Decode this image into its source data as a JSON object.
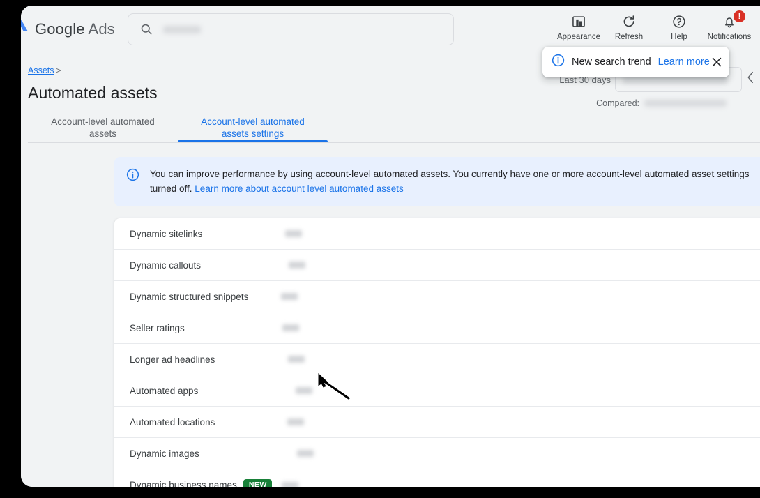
{
  "header": {
    "brand_google": "Google",
    "brand_ads": "Ads",
    "logo_icon": "google-ads-logo",
    "search": {
      "icon": "search-icon",
      "value": "",
      "placeholder": ""
    },
    "actions": [
      {
        "id": "appearance",
        "label": "Appearance",
        "icon": "appearance-icon"
      },
      {
        "id": "refresh",
        "label": "Refresh",
        "icon": "refresh-icon"
      },
      {
        "id": "help",
        "label": "Help",
        "icon": "help-icon"
      },
      {
        "id": "notifications",
        "label": "Notifications",
        "icon": "bell-icon",
        "badge": "!"
      }
    ]
  },
  "toast": {
    "icon": "info-icon",
    "message": "New search trend",
    "link": "Learn more",
    "close_icon": "close-icon"
  },
  "date_range": {
    "label": "Last 30 days",
    "value": "",
    "compared_label": "Compared:",
    "compared_value": "",
    "collapse_icon": "chevron-left-icon"
  },
  "breadcrumb": {
    "items": [
      "Assets"
    ],
    "separator": ">"
  },
  "page": {
    "title": "Automated assets"
  },
  "tabs": [
    {
      "id": "account-level-automated-assets",
      "label": "Account-level automated assets",
      "active": false
    },
    {
      "id": "account-level-automated-assets-settings",
      "label": "Account-level automated assets settings",
      "active": true
    }
  ],
  "info_banner": {
    "icon": "info-outline-icon",
    "text_before": "You can improve performance by using account-level automated assets. You currently have one or more account-level automated asset settings turned off. ",
    "link": "Learn more about account level automated assets"
  },
  "settings_rows": [
    {
      "label": "Dynamic sitelinks",
      "status": "",
      "badge": null
    },
    {
      "label": "Dynamic callouts",
      "status": "",
      "badge": null
    },
    {
      "label": "Dynamic structured snippets",
      "status": "",
      "badge": null
    },
    {
      "label": "Seller ratings",
      "status": "",
      "badge": null
    },
    {
      "label": "Longer ad headlines",
      "status": "",
      "badge": null
    },
    {
      "label": "Automated apps",
      "status": "",
      "badge": null
    },
    {
      "label": "Automated locations",
      "status": "",
      "badge": null
    },
    {
      "label": "Dynamic images",
      "status": "",
      "badge": null
    },
    {
      "label": "Dynamic business names",
      "status": "",
      "badge": "NEW"
    }
  ],
  "cursor": {
    "icon": "mouse-arrow-cursor"
  },
  "colors": {
    "accent_blue": "#1a73e8",
    "banner_bg": "#e8f0fe",
    "badge_green": "#188038",
    "badge_red": "#d93025",
    "page_bg": "#f1f3f4",
    "card_bg": "#ffffff",
    "text_primary": "#202124",
    "text_secondary": "#5f6368"
  }
}
